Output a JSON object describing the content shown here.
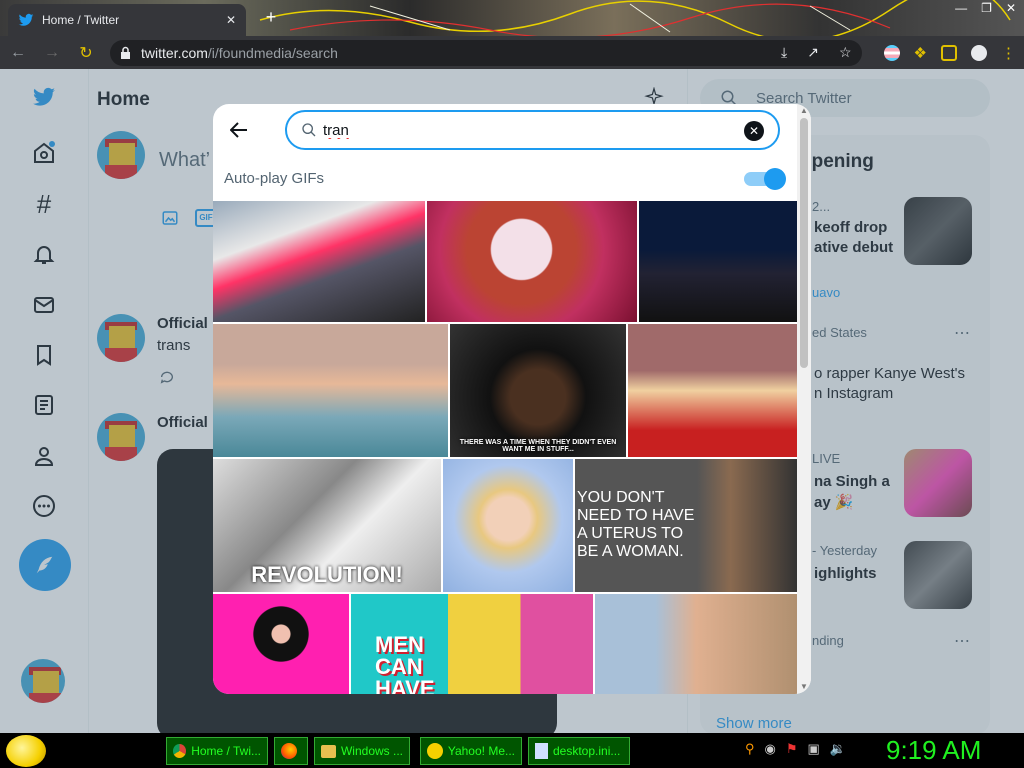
{
  "browser": {
    "tab_title": "Home / Twitter",
    "tab_close": "✕",
    "new_tab": "+",
    "url_host": "twitter.com",
    "url_path": "/i/foundmedia/search"
  },
  "twitter": {
    "home_title": "Home",
    "composer_placeholder": "What’",
    "search_placeholder": "Search Twitter",
    "happening_title": "ppening",
    "tweets": [
      {
        "author": "Official",
        "text": "trans"
      },
      {
        "author": "Official",
        "text": ""
      }
    ],
    "trends": [
      {
        "meta": "2...",
        "line1": "keoff drop",
        "line2": "ative debut",
        "extra": "uavo"
      },
      {
        "meta": "ed States",
        "line1": "o rapper Kanye West's",
        "line2": "n Instagram"
      },
      {
        "meta": "LIVE",
        "line1": "na Singh a",
        "line2": "ay 🎉"
      },
      {
        "meta": "- Yesterday",
        "line1": "ighlights"
      },
      {
        "meta": "nding"
      }
    ],
    "show_more": "Show more"
  },
  "modal": {
    "search_value": "tran",
    "autoplay_label": "Auto-play GIFs",
    "autoplay_on": true,
    "gifs": [
      {
        "name": "gif-pride-parade",
        "caption": ""
      },
      {
        "name": "gif-drag-queen-crying",
        "caption": ""
      },
      {
        "name": "gif-jimmy-fallon",
        "caption": ""
      },
      {
        "name": "gif-hot-tub-men",
        "caption": ""
      },
      {
        "name": "gif-wig-woman",
        "caption": "THERE WAS A TIME WHEN THEY DIDN'T EVEN WANT ME IN STUFF..."
      },
      {
        "name": "gif-singing-child",
        "caption": ""
      },
      {
        "name": "gif-revolution",
        "caption": "REVOLUTION!"
      },
      {
        "name": "gif-blonde-woman",
        "caption": ""
      },
      {
        "name": "gif-uterus-quote",
        "caption": "YOU DON'T NEED TO HAVE A UTERUS TO BE A WOMAN."
      },
      {
        "name": "gif-woman-pink-bg",
        "caption": ""
      },
      {
        "name": "gif-men-can-have",
        "caption": "MEN CAN HAVE"
      },
      {
        "name": "gif-man-with-cap",
        "caption": ""
      }
    ]
  },
  "taskbar": {
    "items": [
      "Home / Twi...",
      "",
      "Windows ...",
      "Yahoo! Me...",
      "desktop.ini..."
    ],
    "clock": "9:19 AM"
  },
  "colors": {
    "accent": "#1d9bf0",
    "clock": "#20f020"
  }
}
